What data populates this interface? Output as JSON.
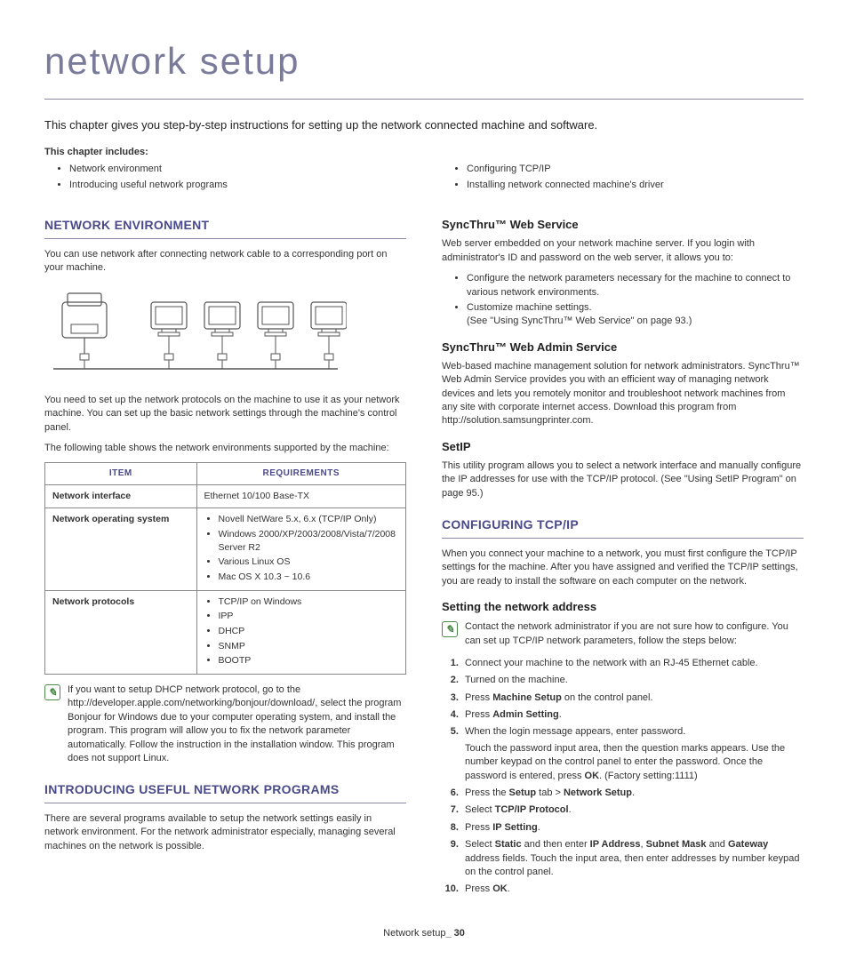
{
  "title": "network setup",
  "intro": "This chapter gives you step-by-step instructions for setting up the network connected machine and software.",
  "includes_label": "This chapter includes:",
  "includes_left": [
    "Network environment",
    "Introducing useful network programs"
  ],
  "includes_right": [
    "Configuring TCP/IP",
    "Installing network connected machine's driver"
  ],
  "netenv": {
    "heading": "Network Environment",
    "p1": "You can use network after connecting network cable to a corresponding port on your machine.",
    "p2": "You need to set up the network protocols on the machine to use it as your network machine. You can set up the basic network settings through the machine's control panel.",
    "p3": "The following table shows the network environments supported by the machine:",
    "table": {
      "head_item": "Item",
      "head_req": "Requirements",
      "rows": [
        {
          "item": "Network interface",
          "req_text": "Ethernet 10/100 Base-TX"
        },
        {
          "item": "Network operating system",
          "req_list": [
            "Novell NetWare 5.x, 6.x (TCP/IP Only)",
            "Windows 2000/XP/2003/2008/Vista/7/2008 Server R2",
            "Various Linux OS",
            "Mac OS X 10.3 ~ 10.6"
          ]
        },
        {
          "item": "Network protocols",
          "req_list": [
            "TCP/IP on Windows",
            "IPP",
            "DHCP",
            "SNMP",
            "BOOTP"
          ]
        }
      ]
    },
    "note": "If you want to setup DHCP network protocol, go to the http://developer.apple.com/networking/bonjour/download/, select the program Bonjour for Windows due to your computer operating system, and install the program. This program will allow you to fix the network parameter automatically. Follow the instruction in the installation window. This program does not support Linux."
  },
  "intro_programs": {
    "heading": "Introducing Useful Network Programs",
    "p1": "There are several programs available to setup the network settings easily in network environment. For the network administrator especially, managing several machines on the network is possible."
  },
  "sync_web": {
    "heading": "SyncThru™ Web Service",
    "p1": "Web server embedded on your network machine server. If you login with administrator's ID and password on the web server, it allows you to:",
    "bullets": [
      "Configure the network parameters necessary for the machine to connect to various network environments.",
      "Customize machine settings."
    ],
    "see": "(See \"Using SyncThru™ Web Service\" on page 93.)"
  },
  "sync_admin": {
    "heading": "SyncThru™ Web Admin Service",
    "p1": "Web-based machine management solution for network administrators. SyncThru™ Web Admin Service provides you with an efficient way of managing network devices and lets you remotely monitor and troubleshoot network machines from any site with corporate internet access. Download this program from http://solution.samsungprinter.com."
  },
  "setip": {
    "heading": "SetIP",
    "p1": "This utility program allows you to select a network interface and manually configure the IP addresses for use with the TCP/IP protocol. (See \"Using SetIP Program\" on page 95.)"
  },
  "tcpip": {
    "heading": "Configuring TCP/IP",
    "p1": "When you connect your machine to a network, you must first configure the TCP/IP settings for the machine. After you have assigned and verified the TCP/IP settings, you are ready to install the software on each computer on the network."
  },
  "setnet": {
    "heading": "Setting the network address",
    "note": "Contact the network administrator if you are not sure how to configure. You can set up TCP/IP network parameters, follow the steps below:",
    "steps": [
      {
        "html": "Connect your machine to the network with an RJ-45 Ethernet cable."
      },
      {
        "html": "Turned on the machine."
      },
      {
        "html": "Press <b>Machine Setup</b> on the control panel."
      },
      {
        "html": "Press <b>Admin Setting</b>."
      },
      {
        "html": "When the login message appears, enter password.",
        "extra": "Touch the password input area, then the question marks appears. Use the number keypad on the control panel to enter the password. Once the password is entered, press <b>OK</b>. (Factory setting:1111)"
      },
      {
        "html": "Press the <b>Setup</b> tab > <b>Network Setup</b>."
      },
      {
        "html": "Select <b>TCP/IP Protocol</b>."
      },
      {
        "html": "Press <b>IP Setting</b>."
      },
      {
        "html": "Select <b>Static</b> and then enter <b>IP Address</b>, <b>Subnet Mask</b> and <b>Gateway</b> address fields. Touch the input area, then enter addresses by number keypad on the control panel."
      },
      {
        "html": "Press <b>OK</b>."
      }
    ]
  },
  "footer_label": "Network setup",
  "footer_page": "30"
}
